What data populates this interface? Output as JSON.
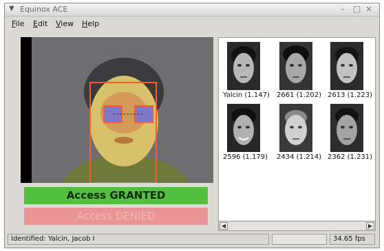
{
  "window": {
    "title": "Equinox ACE"
  },
  "menu": [
    {
      "label": "File",
      "key": "F"
    },
    {
      "label": "Edit",
      "key": "E"
    },
    {
      "label": "View",
      "key": "V"
    },
    {
      "label": "Help",
      "key": "H"
    }
  ],
  "video": {
    "face_box_color": "#ff5a2a",
    "overlay_color": "#e8e24a"
  },
  "access": {
    "granted": "Access GRANTED",
    "denied": "Access DENIED",
    "granted_color": "#55bf3f",
    "denied_color": "#e99595"
  },
  "gallery": {
    "matches": [
      {
        "caption": "Yalcin (1.147)"
      },
      {
        "caption": "2661 (1.202)"
      },
      {
        "caption": "2613 (1.223)"
      },
      {
        "caption": "2596 (1.179)"
      },
      {
        "caption": "2434 (1.214)"
      },
      {
        "caption": "2362 (1.231)"
      }
    ]
  },
  "status": {
    "identified": "Identified: Yalcin, Jacob I",
    "fps": "34.65 fps"
  }
}
